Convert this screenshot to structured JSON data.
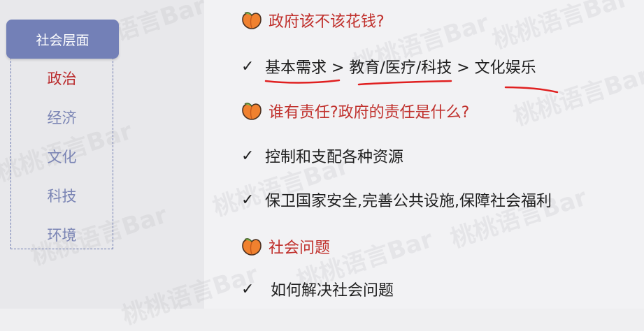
{
  "sidebar": {
    "header": "社会层面",
    "items": [
      "政治",
      "经济",
      "文化",
      "科技",
      "环境"
    ],
    "active_index": 0
  },
  "sections": [
    {
      "heading": "政府该不该花钱?",
      "bullets": [
        "基本需求 > 教育/医疗/科技 > 文化娱乐"
      ]
    },
    {
      "heading": "谁有责任?政府的责任是什么?",
      "bullets": [
        "控制和支配各种资源",
        "保卫国家安全,完善公共设施,保障社会福利"
      ]
    },
    {
      "heading": "社会问题",
      "bullets": [
        "如何解决社会问题"
      ]
    }
  ],
  "check_mark": "✓",
  "watermark": "桃桃语言Bar",
  "colors": {
    "accent_red": "#c0302c",
    "nav_blue": "#7380b7",
    "annotation_red": "#e02020"
  },
  "icons": {
    "heading_icon": "peach-icon",
    "bullet_icon": "check-icon"
  }
}
